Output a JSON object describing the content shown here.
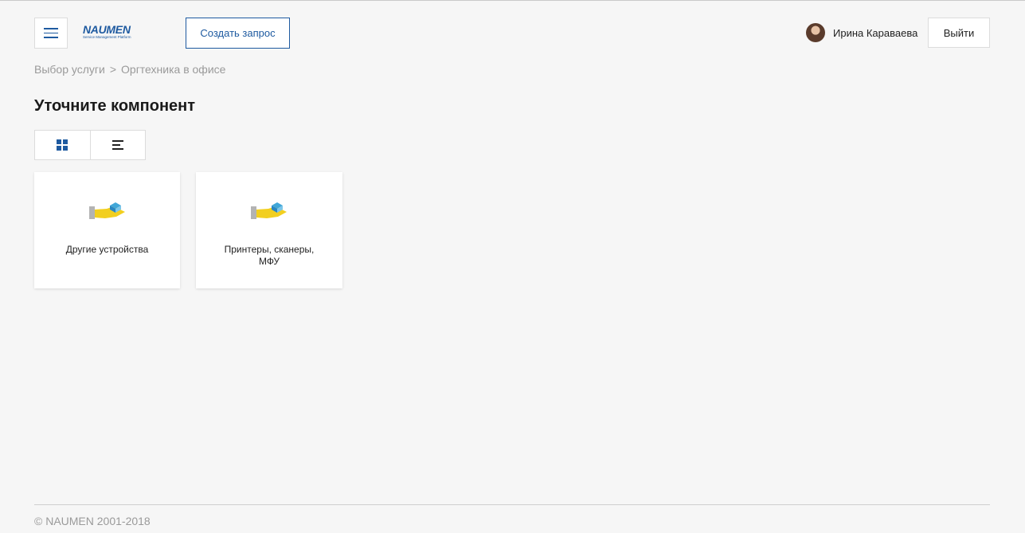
{
  "header": {
    "menu_icon": "hamburger-icon",
    "logo": {
      "word": "NAUMEN",
      "sub": "Service Management Platform"
    },
    "create_request_label": "Создать запрос",
    "user_name": "Ирина Караваева",
    "logout_label": "Выйти"
  },
  "breadcrumb": {
    "items": [
      "Выбор услуги",
      "Оргтехника в офисе"
    ],
    "separator": ">"
  },
  "page_title": "Уточните компонент",
  "view_toggle": {
    "options": [
      "grid-icon",
      "list-icon"
    ],
    "selected": "grid"
  },
  "cards": [
    {
      "label": "Другие устройства",
      "icon": "service-hand-icon"
    },
    {
      "label": "Принтеры, сканеры,\nМФУ",
      "icon": "service-hand-icon"
    }
  ],
  "footer": {
    "copyright": "© NAUMEN 2001-2018"
  },
  "colors": {
    "accent": "#1e5aa0",
    "background": "#f6f6f6",
    "muted": "#9a9a9a"
  }
}
